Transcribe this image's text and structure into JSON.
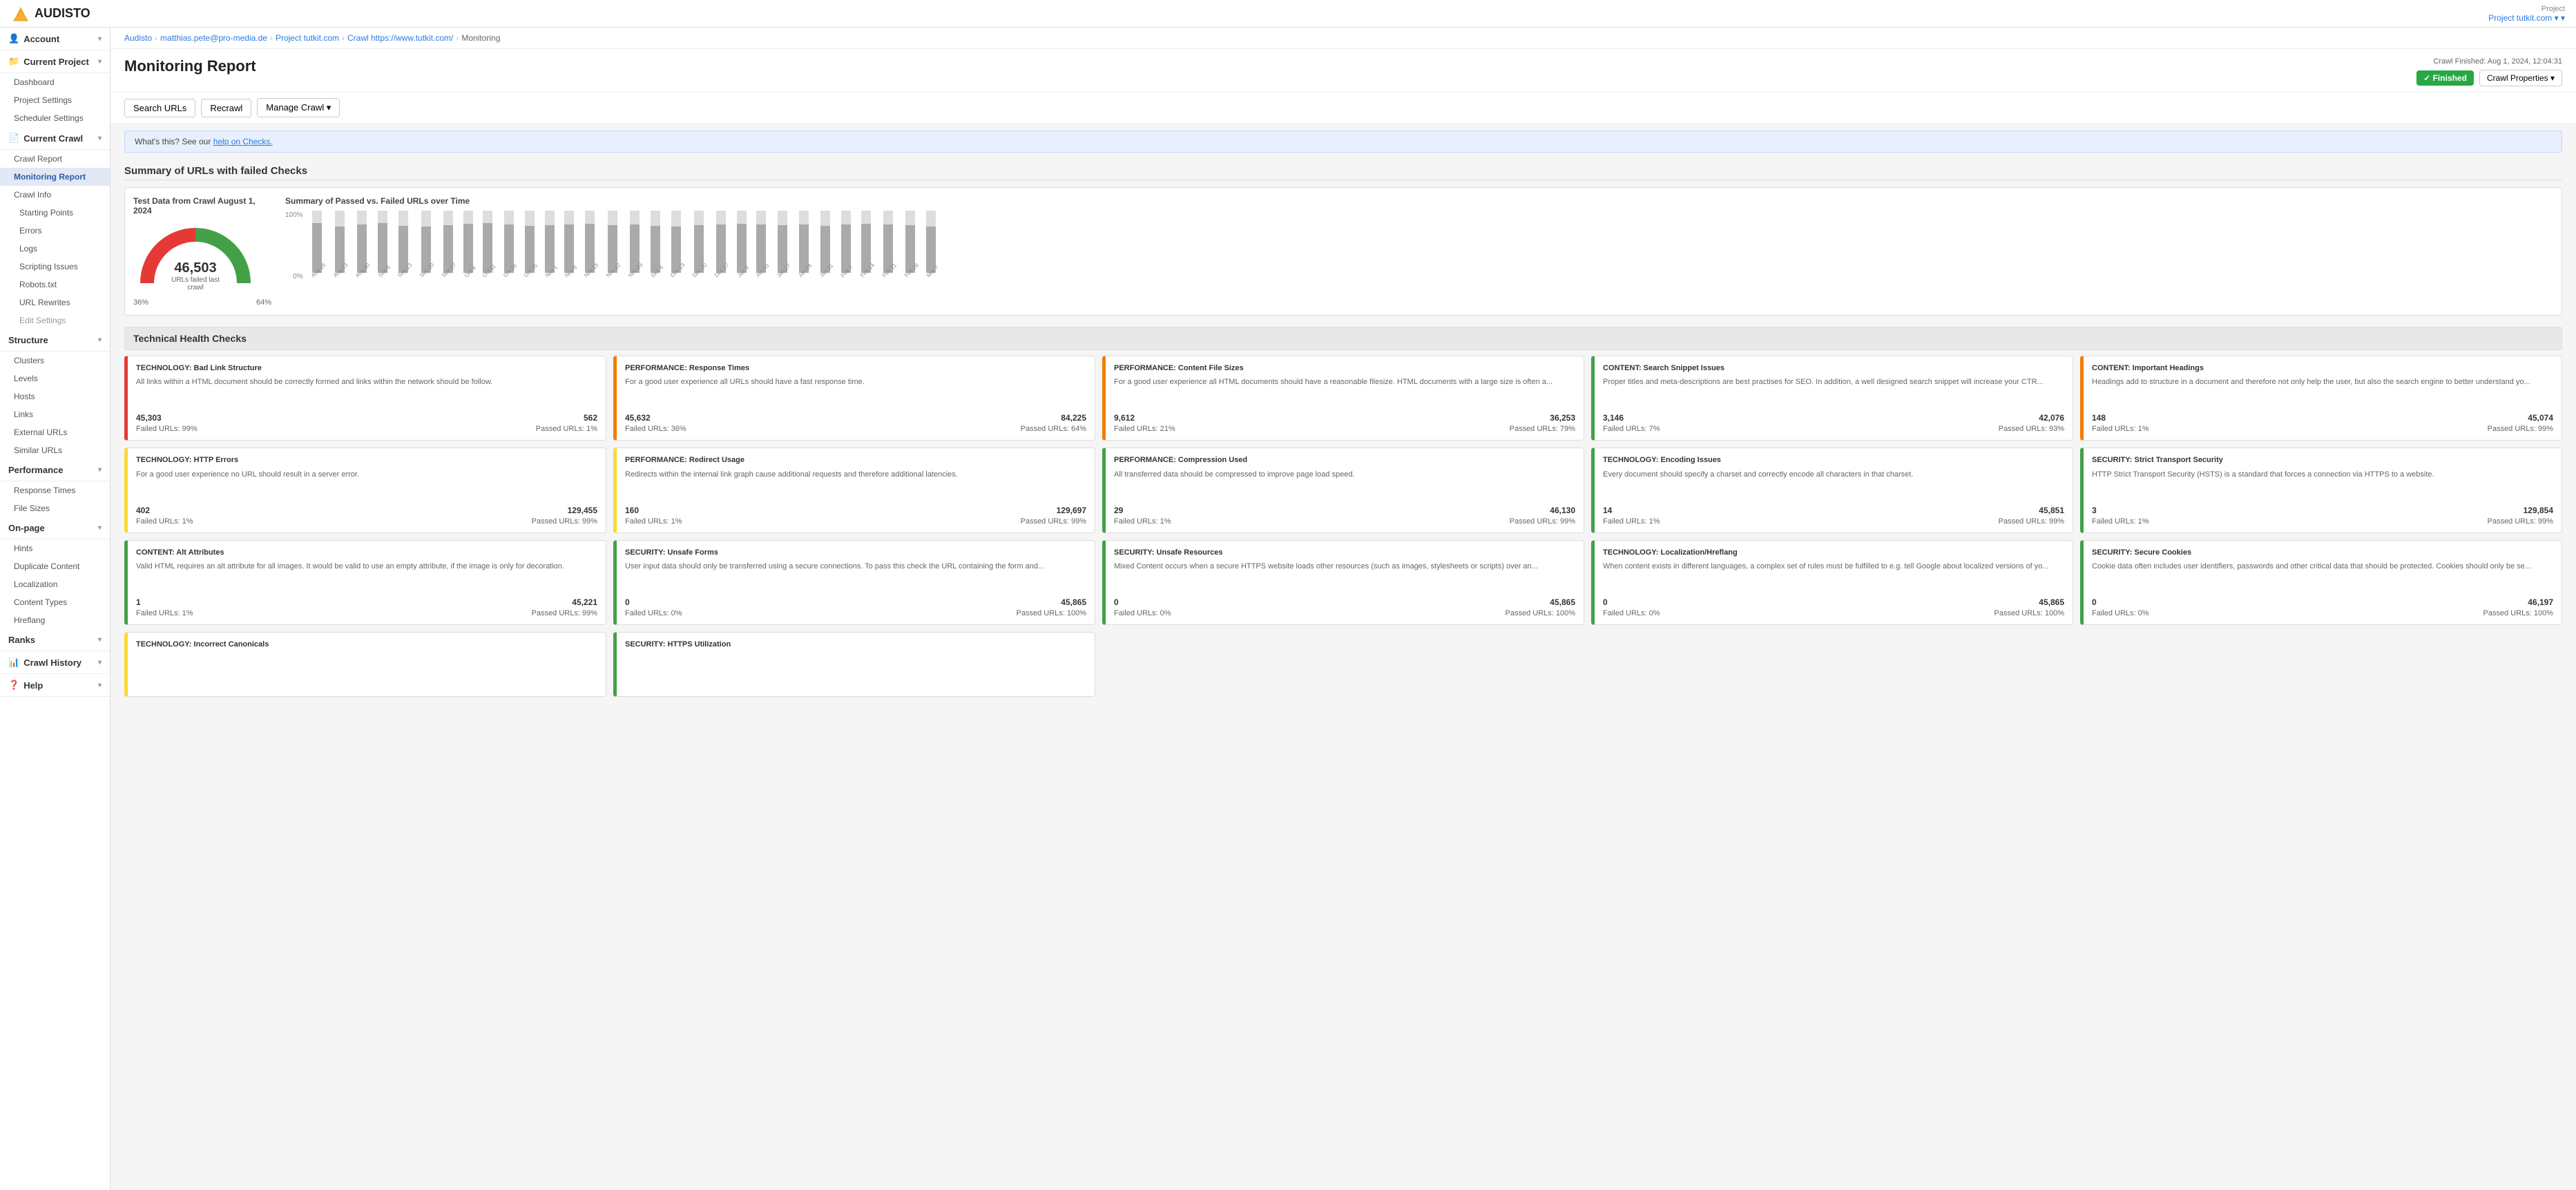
{
  "header": {
    "logo_text": "AUDISTO",
    "project_label": "Project",
    "project_name": "Project tutkit.com",
    "project_link": "Project tutkit.com ▾"
  },
  "breadcrumb": {
    "items": [
      "Audisto",
      "matthias.pete@pro-media.de",
      "Project tutkit.com",
      "Crawl https://www.tutkit.com/",
      "Monitoring"
    ]
  },
  "page": {
    "title": "Monitoring Report",
    "crawl_finished": "Crawl Finished: Aug 1, 2024, 12:04:31",
    "finished_label": "✓ Finished",
    "crawl_properties_label": "Crawl Properties ▾"
  },
  "action_bar": {
    "search_urls": "Search URLs",
    "recrawl": "Recrawl",
    "manage_crawl": "Manage Crawl ▾"
  },
  "info_bar": {
    "text": "What's this? See our ",
    "link_text": "help on Checks.",
    "link": "#"
  },
  "summary": {
    "title": "Summary of URLs with failed Checks",
    "gauge": {
      "title": "Test Data from Crawl August 1, 2024",
      "big_number": "46,503",
      "label": "URLs failed last crawl",
      "pct_left": "36%",
      "pct_right": "64%"
    },
    "chart": {
      "title": "Summary of Passed vs. Failed URLs over Time",
      "y_labels": [
        "100%",
        "0%"
      ],
      "bars": [
        {
          "label": "Aug 16",
          "pass": 80,
          "fail": 20
        },
        {
          "label": "Aug 23",
          "pass": 75,
          "fail": 25
        },
        {
          "label": "Aug 30",
          "pass": 78,
          "fail": 22
        },
        {
          "label": "Sep 6",
          "pass": 80,
          "fail": 20
        },
        {
          "label": "Sep 13",
          "pass": 76,
          "fail": 24
        },
        {
          "label": "Sep 20",
          "pass": 75,
          "fail": 25
        },
        {
          "label": "Sep 27",
          "pass": 77,
          "fail": 23
        },
        {
          "label": "Oct 4",
          "pass": 79,
          "fail": 21
        },
        {
          "label": "Oct 11",
          "pass": 80,
          "fail": 20
        },
        {
          "label": "Oct 18",
          "pass": 78,
          "fail": 22
        },
        {
          "label": "Oct 25",
          "pass": 76,
          "fail": 24
        },
        {
          "label": "Nov 1",
          "pass": 77,
          "fail": 23
        },
        {
          "label": "Nov 8",
          "pass": 78,
          "fail": 22
        },
        {
          "label": "Nov 15",
          "pass": 79,
          "fail": 21
        },
        {
          "label": "Nov 22",
          "pass": 77,
          "fail": 23
        },
        {
          "label": "Nov 29",
          "pass": 78,
          "fail": 22
        },
        {
          "label": "Dec 6",
          "pass": 76,
          "fail": 24
        },
        {
          "label": "Dec 13",
          "pass": 75,
          "fail": 25
        },
        {
          "label": "Dec 20",
          "pass": 77,
          "fail": 23
        },
        {
          "label": "Dec 27",
          "pass": 78,
          "fail": 22
        },
        {
          "label": "Jan 3",
          "pass": 79,
          "fail": 21
        },
        {
          "label": "Jan 10",
          "pass": 78,
          "fail": 22
        },
        {
          "label": "Jan 17",
          "pass": 77,
          "fail": 23
        },
        {
          "label": "Jan 24",
          "pass": 78,
          "fail": 22
        },
        {
          "label": "Jan 31",
          "pass": 76,
          "fail": 24
        },
        {
          "label": "Feb 7",
          "pass": 78,
          "fail": 22
        },
        {
          "label": "Feb 14",
          "pass": 79,
          "fail": 21
        },
        {
          "label": "Feb 21",
          "pass": 78,
          "fail": 22
        },
        {
          "label": "Feb 28",
          "pass": 77,
          "fail": 23
        },
        {
          "label": "Mar 7",
          "pass": 75,
          "fail": 25
        }
      ]
    }
  },
  "health_section_title": "Technical Health Checks",
  "health_cards": [
    {
      "color": "red",
      "title": "TECHNOLOGY: Bad Link Structure",
      "desc": "All links within a HTML document should be correctly formed and links within the network should be follow.",
      "num1": "45,303",
      "num2": "562",
      "failed_pct": "Failed URLs: 99%",
      "passed_pct": "Passed URLs: 1%"
    },
    {
      "color": "orange",
      "title": "PERFORMANCE: Response Times",
      "desc": "For a good user experience all URLs should have a fast response time.",
      "num1": "45,632",
      "num2": "84,225",
      "failed_pct": "Failed URLs: 36%",
      "passed_pct": "Passed URLs: 64%"
    },
    {
      "color": "orange",
      "title": "PERFORMANCE: Content File Sizes",
      "desc": "For a good user experience all HTML documents should have a reasonable filesize. HTML documents with a large size is often a...",
      "num1": "9,612",
      "num2": "36,253",
      "failed_pct": "Failed URLs: 21%",
      "passed_pct": "Passed URLs: 79%"
    },
    {
      "color": "green",
      "title": "CONTENT: Search Snippet Issues",
      "desc": "Proper titles and meta-descriptions are best practises for SEO. In addition, a well designed search snippet will increase your CTR...",
      "num1": "3,146",
      "num2": "42,076",
      "failed_pct": "Failed URLs: 7%",
      "passed_pct": "Passed URLs: 93%"
    },
    {
      "color": "orange",
      "title": "CONTENT: Important Headings",
      "desc": "Headings add to structure in a document and therefore not only help the user, but also the search engine to better understand yo...",
      "num1": "148",
      "num2": "45,074",
      "failed_pct": "Failed URLs: 1%",
      "passed_pct": "Passed URLs: 99%"
    },
    {
      "color": "yellow",
      "title": "TECHNOLOGY: HTTP Errors",
      "desc": "For a good user experience no URL should result in a server error.",
      "num1": "402",
      "num2": "129,455",
      "failed_pct": "Failed URLs: 1%",
      "passed_pct": "Passed URLs: 99%"
    },
    {
      "color": "yellow",
      "title": "PERFORMANCE: Redirect Usage",
      "desc": "Redirects within the internal link graph cause additional requests and therefore additional latencies.",
      "num1": "160",
      "num2": "129,697",
      "failed_pct": "Failed URLs: 1%",
      "passed_pct": "Passed URLs: 99%"
    },
    {
      "color": "green",
      "title": "PERFORMANCE: Compression Used",
      "desc": "All transferred data should be compressed to improve page load speed.",
      "num1": "29",
      "num2": "46,130",
      "failed_pct": "Failed URLs: 1%",
      "passed_pct": "Passed URLs: 99%"
    },
    {
      "color": "green",
      "title": "TECHNOLOGY: Encoding Issues",
      "desc": "Every document should specify a charset and correctly encode all characters in that charset.",
      "num1": "14",
      "num2": "45,851",
      "failed_pct": "Failed URLs: 1%",
      "passed_pct": "Passed URLs: 99%"
    },
    {
      "color": "green",
      "title": "SECURITY: Strict Transport Security",
      "desc": "HTTP Strict Transport Security (HSTS) is a standard that forces a connection via HTTPS to a website.",
      "num1": "3",
      "num2": "129,854",
      "failed_pct": "Failed URLs: 1%",
      "passed_pct": "Passed URLs: 99%"
    },
    {
      "color": "green",
      "title": "CONTENT: Alt Attributes",
      "desc": "Valid HTML requires an alt attribute for all images. It would be valid to use an empty attribute, if the image is only for decoration.",
      "num1": "1",
      "num2": "45,221",
      "failed_pct": "Failed URLs: 1%",
      "passed_pct": "Passed URLs: 99%"
    },
    {
      "color": "green",
      "title": "SECURITY: Unsafe Forms",
      "desc": "User input data should only be transferred using a secure connections. To pass this check the URL containing the form and...",
      "num1": "0",
      "num2": "45,865",
      "failed_pct": "Failed URLs: 0%",
      "passed_pct": "Passed URLs: 100%"
    },
    {
      "color": "green",
      "title": "SECURITY: Unsafe Resources",
      "desc": "Mixed Content occurs when a secure HTTPS website loads other resources (such as images, stylesheets or scripts) over an...",
      "num1": "0",
      "num2": "45,865",
      "failed_pct": "Failed URLs: 0%",
      "passed_pct": "Passed URLs: 100%"
    },
    {
      "color": "green",
      "title": "TECHNOLOGY: Localization/Hreflang",
      "desc": "When content exists in different languages, a complex set of rules must be fulfilled to e.g. tell Google about localized versions of yo...",
      "num1": "0",
      "num2": "45,865",
      "failed_pct": "Failed URLs: 0%",
      "passed_pct": "Passed URLs: 100%"
    },
    {
      "color": "green",
      "title": "SECURITY: Secure Cookies",
      "desc": "Cookie data often includes user identifiers, passwords and other critical data that should be protected. Cookies should only be se...",
      "num1": "0",
      "num2": "46,197",
      "failed_pct": "Failed URLs: 0%",
      "passed_pct": "Passed URLs: 100%"
    },
    {
      "color": "yellow",
      "title": "TECHNOLOGY: Incorrect Canonicals",
      "desc": "",
      "num1": "",
      "num2": "",
      "failed_pct": "",
      "passed_pct": ""
    },
    {
      "color": "green",
      "title": "SECURITY: HTTPS Utilization",
      "desc": "",
      "num1": "",
      "num2": "",
      "failed_pct": "",
      "passed_pct": ""
    }
  ],
  "sidebar": {
    "account_label": "Account",
    "current_project_label": "Current Project",
    "dashboard_label": "Dashboard",
    "project_settings_label": "Project Settings",
    "scheduler_settings_label": "Scheduler Settings",
    "current_crawl_label": "Current Crawl",
    "crawl_report_label": "Crawl Report",
    "monitoring_report_label": "Monitoring Report",
    "crawl_info_label": "Crawl Info",
    "starting_points_label": "Starting Points",
    "errors_label": "Errors",
    "logs_label": "Logs",
    "scripting_issues_label": "Scripting Issues",
    "robots_txt_label": "Robots.txt",
    "url_rewrites_label": "URL Rewrites",
    "edit_settings_label": "Edit Settings",
    "structure_label": "Structure",
    "clusters_label": "Clusters",
    "levels_label": "Levels",
    "hosts_label": "Hosts",
    "links_label": "Links",
    "external_urls_label": "External URLs",
    "similar_urls_label": "Similar URLs",
    "performance_label": "Performance",
    "response_times_label": "Response Times",
    "file_sizes_label": "File Sizes",
    "on_page_label": "On-page",
    "hints_label": "Hints",
    "duplicate_content_label": "Duplicate Content",
    "localization_label": "Localization",
    "content_types_label": "Content Types",
    "hreflang_label": "Hreflang",
    "ranks_label": "Ranks",
    "crawl_history_label": "Crawl History",
    "help_label": "Help"
  }
}
